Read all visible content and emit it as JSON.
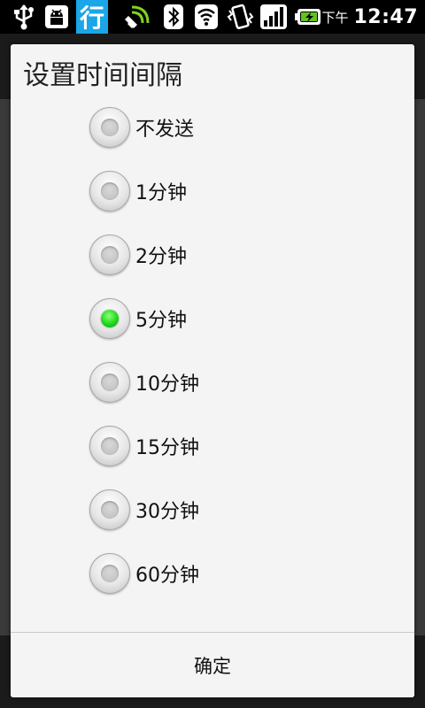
{
  "status_bar": {
    "icons": [
      "usb-icon",
      "android-debug-icon",
      "app-notification-icon",
      "gps-icon",
      "bluetooth-icon",
      "wifi-icon",
      "vibrate-icon",
      "signal-icon",
      "battery-charging-icon"
    ],
    "app_notification_text": "行",
    "ampm": "下午",
    "time": "12:47"
  },
  "dialog": {
    "title": "设置时间间隔",
    "options": [
      {
        "label": "不发送",
        "checked": false
      },
      {
        "label": "1分钟",
        "checked": false
      },
      {
        "label": "2分钟",
        "checked": false
      },
      {
        "label": "5分钟",
        "checked": true
      },
      {
        "label": "10分钟",
        "checked": false
      },
      {
        "label": "15分钟",
        "checked": false
      },
      {
        "label": "30分钟",
        "checked": false
      },
      {
        "label": "60分钟",
        "checked": false
      }
    ],
    "confirm_label": "确定"
  },
  "colors": {
    "radio_checked": "#1fd81a",
    "dialog_bg": "#f4f4f4",
    "status_bar_bg": "#000000"
  }
}
